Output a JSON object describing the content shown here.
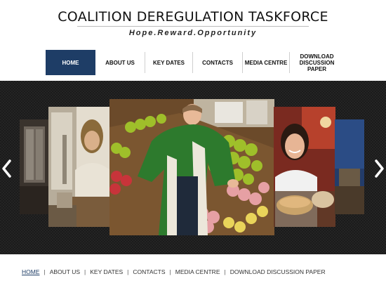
{
  "header": {
    "title": "COALITION DEREGULATION TASKFORCE",
    "tagline": "Hope.Reward.Opportunity"
  },
  "nav": {
    "items": [
      {
        "label": "HOME",
        "active": true
      },
      {
        "label": "ABOUT US",
        "active": false
      },
      {
        "label": "KEY DATES",
        "active": false
      },
      {
        "label": "CONTACTS",
        "active": false
      },
      {
        "label": "MEDIA CENTRE",
        "active": false
      },
      {
        "label": "DOWNLOAD DISCUSSION PAPER",
        "active": false
      }
    ]
  },
  "slider": {
    "prev_icon": "chevron-left-icon",
    "next_icon": "chevron-right-icon",
    "slides": [
      "window-scene",
      "woman-at-desk",
      "grocer-with-fruit",
      "smiling-baker",
      "blue-wall-scene"
    ]
  },
  "footer_nav": {
    "items": [
      {
        "label": "HOME",
        "active": true
      },
      {
        "label": "ABOUT US",
        "active": false
      },
      {
        "label": "KEY DATES",
        "active": false
      },
      {
        "label": "CONTACTS",
        "active": false
      },
      {
        "label": "MEDIA CENTRE",
        "active": false
      },
      {
        "label": "DOWNLOAD DISCUSSION PAPER",
        "active": false
      }
    ]
  },
  "colors": {
    "nav_active": "#1e3d66",
    "slider_bg": "#1b1b1b"
  }
}
